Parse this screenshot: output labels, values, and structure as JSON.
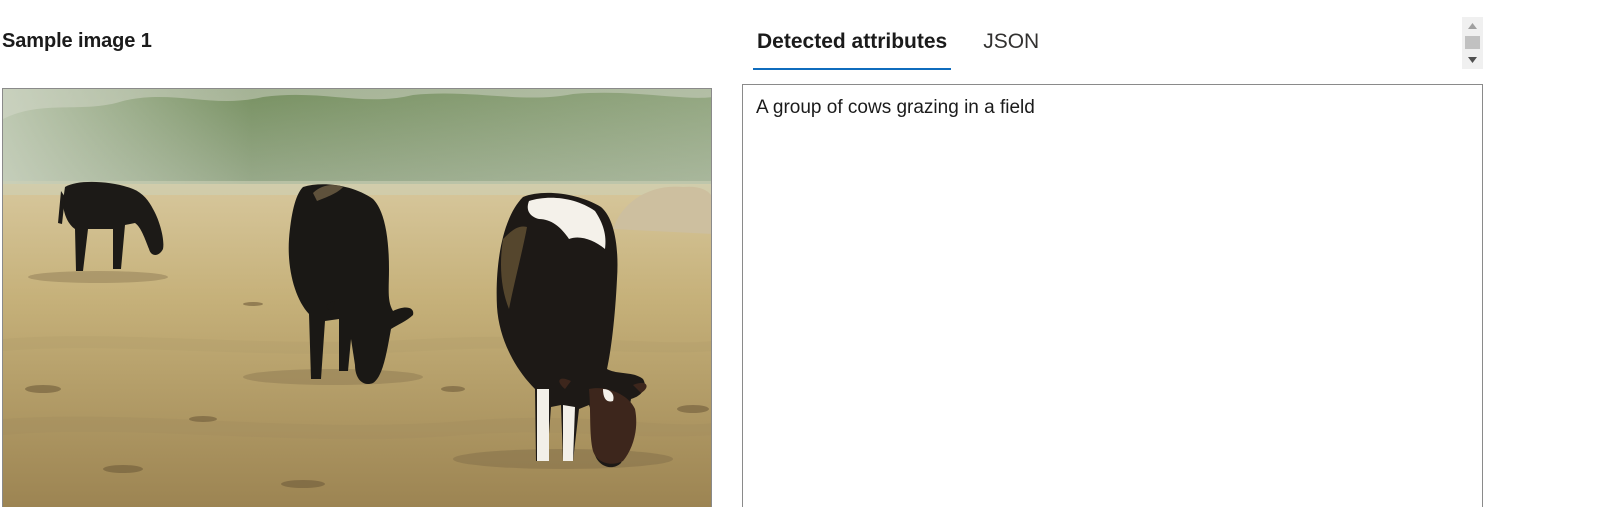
{
  "sample": {
    "title": "Sample image 1"
  },
  "tabs": [
    {
      "label": "Detected attributes",
      "active": true
    },
    {
      "label": "JSON",
      "active": false
    }
  ],
  "result": {
    "caption": "A group of cows grazing in a field"
  },
  "colors": {
    "accent": "#0f6cbd",
    "border": "#8a8a8a",
    "scroll_track": "#f0f0f0",
    "scroll_thumb": "#c1c1c1"
  },
  "icons": {
    "scroll_up": "triangle-up-icon",
    "scroll_down": "triangle-down-icon"
  }
}
